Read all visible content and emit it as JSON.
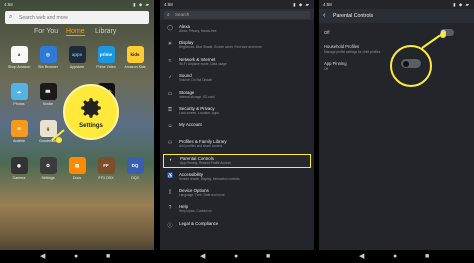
{
  "panel_home": {
    "status_time": "4:58",
    "status_icons": "▮ ◆ ▰",
    "search_placeholder": "Search web and more",
    "tabs": [
      "For You",
      "Home",
      "Library"
    ],
    "active_tab": "Home",
    "apps": [
      {
        "name": "Shop Amazon",
        "icon": "amazon",
        "color": "#f8f8f8",
        "fg": "#222",
        "glyph": "a"
      },
      {
        "name": "Silk Browser",
        "icon": "silk",
        "color": "#2d7bd6",
        "fg": "#fff",
        "glyph": "◎"
      },
      {
        "name": "Appstore",
        "icon": "appstore",
        "color": "#1f2b37",
        "fg": "#4fc3f7",
        "glyph": "apps"
      },
      {
        "name": "Prime Video",
        "icon": "prime",
        "color": "#1b98e0",
        "fg": "#fff",
        "glyph": "prime"
      },
      {
        "name": "Amazon Kids",
        "icon": "kids",
        "color": "#ffcc33",
        "fg": "#222",
        "glyph": "kids"
      },
      {
        "name": "Photos",
        "icon": "photos",
        "color": "#53b2e8",
        "fg": "#fff",
        "glyph": "☁"
      },
      {
        "name": "Kindle",
        "icon": "kindle",
        "color": "#1a1a1a",
        "fg": "#fff",
        "glyph": "📖"
      },
      {
        "name": "IMDb TV",
        "icon": "imdb",
        "color": "#111",
        "fg": "#f5c518",
        "glyph": "IMDb"
      },
      {
        "name": "Audible",
        "icon": "audible",
        "color": "#f79a1c",
        "fg": "#fff",
        "glyph": "≋"
      },
      {
        "name": "Goodreads",
        "icon": "goodreads",
        "color": "#e9e2cf",
        "fg": "#5a3e1b",
        "glyph": "g"
      },
      {
        "name": "Camera",
        "icon": "camera",
        "color": "#333",
        "fg": "#fff",
        "glyph": "◉"
      },
      {
        "name": "Settings",
        "icon": "settings",
        "color": "#3b3b3b",
        "fg": "#fff",
        "glyph": "⚙"
      },
      {
        "name": "Docs",
        "icon": "docs",
        "color": "#ff8a00",
        "fg": "#fff",
        "glyph": "▤"
      },
      {
        "name": "FF3 OSX",
        "icon": "ff3",
        "color": "#7a4f2a",
        "fg": "#fff",
        "glyph": "FF"
      },
      {
        "name": "DQ3",
        "icon": "dq3",
        "color": "#3a5fb0",
        "fg": "#fff",
        "glyph": "DQ"
      }
    ],
    "settings_callout_label": "Settings",
    "accent_color": "#ffe93a",
    "tab_active_color": "#ff9a00"
  },
  "panel_settings": {
    "status_time": "4:58",
    "status_icons": "▮ ◆ ▰",
    "search_placeholder": "Search",
    "items": [
      {
        "title": "Alexa",
        "subtitle": "Alexa, Privacy, Hands-free",
        "icon": "alexa-icon",
        "glyph": "◯"
      },
      {
        "title": "Display",
        "subtitle": "Brightness, Blue Shade, Screen saver, Font size and more",
        "icon": "display-icon",
        "glyph": "☀"
      },
      {
        "title": "Network & Internet",
        "subtitle": "Wi-Fi, Airplane mode, Data usage",
        "icon": "wifi-icon",
        "glyph": "≈"
      },
      {
        "title": "Sound",
        "subtitle": "Volume, Do Not Disturb",
        "icon": "sound-icon",
        "glyph": "♪"
      },
      {
        "title": "Storage",
        "subtitle": "Internal storage, SD card",
        "icon": "storage-icon",
        "glyph": "▭"
      },
      {
        "title": "Security & Privacy",
        "subtitle": "Lock screen, Location, Apps",
        "icon": "lock-icon",
        "glyph": "⚿"
      },
      {
        "title": "My Account",
        "subtitle": "",
        "icon": "account-icon",
        "glyph": "☺"
      },
      {
        "title": "Profiles & Family Library",
        "subtitle": "Add profiles and share content",
        "icon": "profiles-icon",
        "glyph": "⚇"
      },
      {
        "title": "Parental Controls",
        "subtitle": "App Pinning, Restrict Profile Access",
        "icon": "parental-icon",
        "glyph": "◐"
      },
      {
        "title": "Accessibility",
        "subtitle": "Screen reader, Display, Interaction controls",
        "icon": "accessibility-icon",
        "glyph": "♿"
      },
      {
        "title": "Device Options",
        "subtitle": "Language, Time, Date and more",
        "icon": "device-icon",
        "glyph": "▯"
      },
      {
        "title": "Help",
        "subtitle": "Help topics, Contact us",
        "icon": "help-icon",
        "glyph": "?"
      },
      {
        "title": "Legal & Compliance",
        "subtitle": "",
        "icon": "legal-icon",
        "glyph": "ⓘ"
      }
    ],
    "highlighted_item": "Parental Controls"
  },
  "panel_parental": {
    "status_time": "4:58",
    "status_icons": "▮ ◆ ▰",
    "title": "Parental Controls",
    "master_label": "Off",
    "master_on": false,
    "household_title": "Household Profiles",
    "household_subtitle": "Manage profile settings for child profiles",
    "app_pinning_title": "App Pinning",
    "app_pinning_subtitle": "Off",
    "app_pinning_on": false
  },
  "nav": {
    "back": "◀",
    "home": "●",
    "recent": "■"
  }
}
